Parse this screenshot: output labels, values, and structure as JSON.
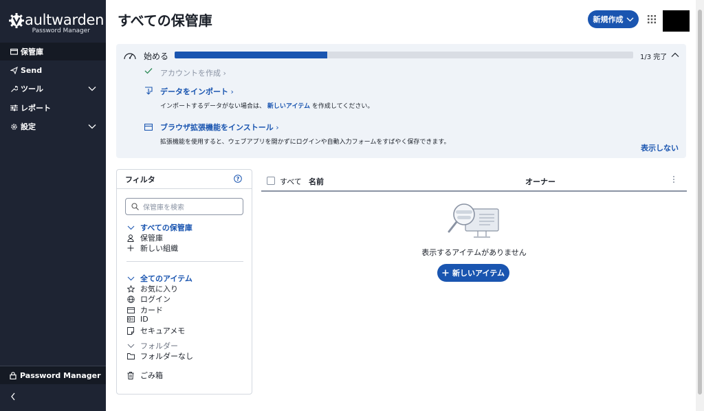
{
  "brand": {
    "name_rest": "aultwarden",
    "subtitle": "Password Manager"
  },
  "sidebar": {
    "items": [
      {
        "label": "保管庫",
        "icon": "vault-icon",
        "active": true
      },
      {
        "label": "Send",
        "icon": "send-icon"
      },
      {
        "label": "ツール",
        "icon": "wrench-icon",
        "expandable": true
      },
      {
        "label": "レポート",
        "icon": "sliders-icon"
      },
      {
        "label": "設定",
        "icon": "gear-icon",
        "expandable": true
      }
    ],
    "footer_label": "Password Manager"
  },
  "header": {
    "title": "すべての保管庫",
    "new_button": "新規作成"
  },
  "getting_started": {
    "title": "始める",
    "progress_fraction": 0.333,
    "count": "1/3 完了",
    "steps": [
      {
        "title": "アカウントを作成",
        "done": true
      },
      {
        "title": "データをインポート",
        "desc_before": "インポートするデータがない場合は、",
        "desc_link": "新しいアイテム",
        "desc_after": "を作成してください。"
      },
      {
        "title": "ブラウザ拡張機能をインストール",
        "desc": "拡張機能を使用すると、ウェブアプリを開かずにログインや自動入力フォームをすばやく保存できます。"
      }
    ],
    "hide": "表示しない"
  },
  "filter": {
    "title": "フィルタ",
    "search_placeholder": "保管庫を検索",
    "vaults_header": "すべての保管庫",
    "vault": "保管庫",
    "new_org": "新しい組織",
    "items_header": "全てのアイテム",
    "favorites": "お気に入り",
    "login": "ログイン",
    "card": "カード",
    "identity": "ID",
    "secure_note": "セキュアメモ",
    "folders_header": "フォルダー",
    "no_folder": "フォルダーなし",
    "trash": "ごみ箱"
  },
  "list": {
    "all": "すべて",
    "name": "名前",
    "owner": "オーナー",
    "empty": "表示するアイテムがありません",
    "new_item": "新しいアイテム"
  },
  "colors": {
    "sidebar": "#1e2433",
    "accent": "#1a55b0",
    "panel": "#eff3f8"
  }
}
